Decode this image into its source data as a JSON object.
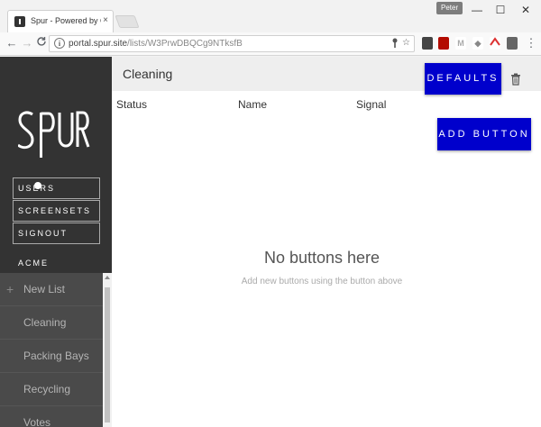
{
  "browser": {
    "tab_title": "Spur - Powered by Contr",
    "tab_close": "×",
    "profile": "Peter",
    "url_host": "portal.spur.site",
    "url_path": "/lists/W3PrwDBQCg9NTksfB",
    "window_minimize": "—",
    "window_maximize": "☐",
    "window_close": "✕",
    "back": "←",
    "forward": "→",
    "reload": "C",
    "menu": "⋮"
  },
  "sidebar": {
    "logo_text": "SPUR",
    "buttons": [
      "USERS",
      "SCREENSETS",
      "SIGNOUT"
    ],
    "org": "ACME",
    "new_list": "New List",
    "lists": [
      "Cleaning",
      "Packing Bays",
      "Recycling",
      "Votes"
    ]
  },
  "main": {
    "title": "Cleaning",
    "defaults_label": "DEFAULTS",
    "add_button_label": "ADD BUTTON",
    "columns": [
      "Status",
      "Name",
      "Signal"
    ],
    "empty_title": "No buttons here",
    "empty_subtitle": "Add new buttons using the button above"
  },
  "colors": {
    "accent": "#0000cc",
    "sidebar_bg": "#333333",
    "list_bg": "#4a4a4a"
  }
}
